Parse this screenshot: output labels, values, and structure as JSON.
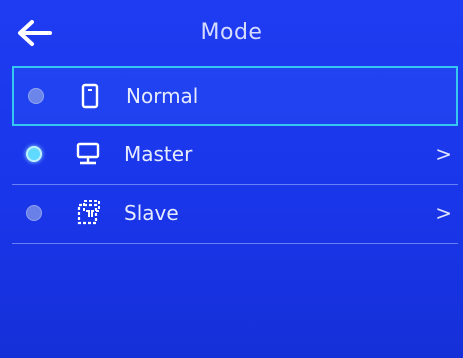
{
  "header": {
    "title": "Mode",
    "back_icon": "arrow-left-icon"
  },
  "modes": [
    {
      "label": "Normal",
      "icon": "phone-icon",
      "selected": true,
      "checked": false,
      "chevron": ""
    },
    {
      "label": "Master",
      "icon": "monitor-icon",
      "selected": false,
      "checked": true,
      "chevron": ">"
    },
    {
      "label": "Slave",
      "icon": "dashed-device-icon",
      "selected": false,
      "checked": false,
      "chevron": ">"
    }
  ],
  "colors": {
    "background": "#1f3cf2",
    "selection_border": "#35c7f0",
    "radio_on": "#5fd9ff"
  }
}
